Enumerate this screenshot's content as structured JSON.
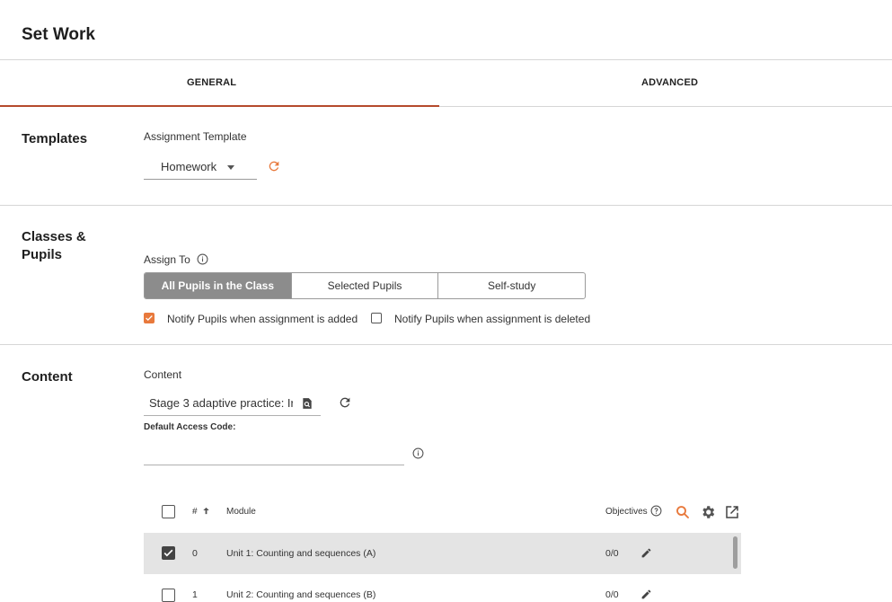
{
  "page_title": "Set Work",
  "tabs": [
    {
      "label": "GENERAL",
      "active": true
    },
    {
      "label": "ADVANCED",
      "active": false
    }
  ],
  "templates": {
    "section_title": "Templates",
    "field_label": "Assignment Template",
    "selected_value": "Homework"
  },
  "classes": {
    "section_title": "Classes & Pupils",
    "assign_to_label": "Assign To",
    "options": [
      "All Pupils in the Class",
      "Selected Pupils",
      "Self-study"
    ],
    "selected_option": "All Pupils in the Class",
    "notify_added": {
      "label": "Notify Pupils when assignment is added",
      "checked": true
    },
    "notify_deleted": {
      "label": "Notify Pupils when assignment is deleted",
      "checked": false
    }
  },
  "content": {
    "section_title": "Content",
    "field_label": "Content",
    "content_value": "Stage 3 adaptive practice: Ir",
    "access_code_label": "Default Access Code:",
    "access_code_value": ""
  },
  "table": {
    "headers": {
      "num": "#",
      "module": "Module",
      "objectives": "Objectives"
    },
    "rows": [
      {
        "num": "0",
        "module": "Unit 1: Counting and sequences (A)",
        "objectives": "0/0",
        "checked": true
      },
      {
        "num": "1",
        "module": "Unit 2: Counting and sequences (B)",
        "objectives": "0/0",
        "checked": false
      }
    ]
  },
  "colors": {
    "accent": "#e8793c",
    "tab_underline": "#b54a2c",
    "segment_active": "#8c8c8c"
  }
}
